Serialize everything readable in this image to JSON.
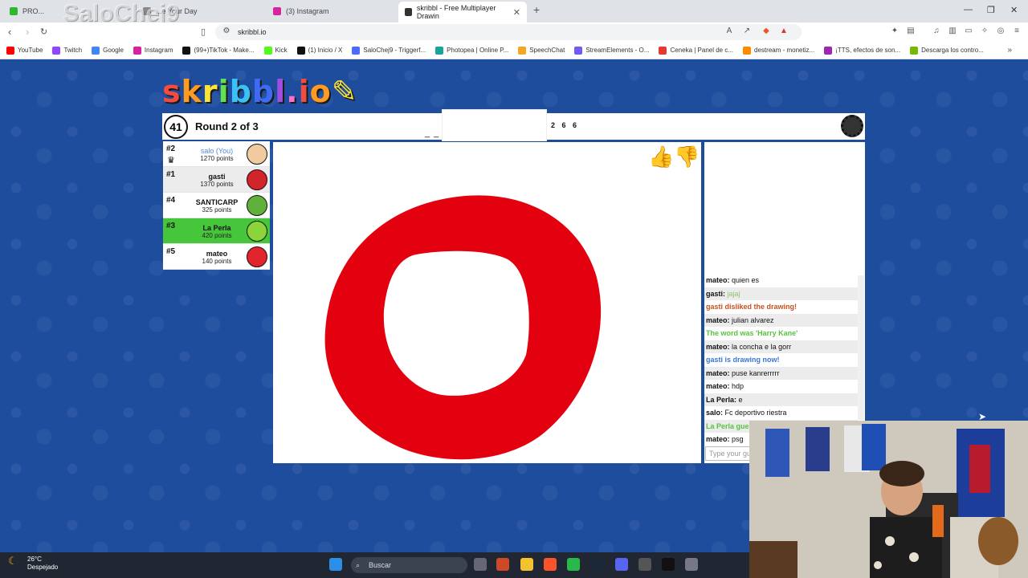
{
  "tabs": [
    {
      "label": "PRO...",
      "color": "#2eb82e"
    },
    {
      "label": "...e Your Day",
      "color": "#888888"
    },
    {
      "label": "(3) Instagram",
      "color": "#d6249f"
    },
    {
      "label": "skribbl - Free Multiplayer Drawin",
      "color": "#333333"
    }
  ],
  "url": "skribbl.io",
  "watermark": "SaloChej9",
  "bookmarks": [
    {
      "label": "YouTube",
      "color": "#ff0000"
    },
    {
      "label": "Twitch",
      "color": "#9146ff"
    },
    {
      "label": "Google",
      "color": "#4285f4"
    },
    {
      "label": "Instagram",
      "color": "#d6249f"
    },
    {
      "label": "(99+)TikTok - Make...",
      "color": "#111111"
    },
    {
      "label": "Kick",
      "color": "#53fc18"
    },
    {
      "label": "(1) Inicio / X",
      "color": "#111111"
    },
    {
      "label": "SaloChej9 - Triggerf...",
      "color": "#4a6cf7"
    },
    {
      "label": "Photopea | Online P...",
      "color": "#18a497"
    },
    {
      "label": "SpeechChat",
      "color": "#f5a623"
    },
    {
      "label": "StreamElements - O...",
      "color": "#6e5cf6"
    },
    {
      "label": "Ceneka | Panel de c...",
      "color": "#e53935"
    },
    {
      "label": "destream - monetiz...",
      "color": "#ff8a00"
    },
    {
      "label": "¡TTS, efectos de son...",
      "color": "#9c27b0"
    },
    {
      "label": "Descarga los contro...",
      "color": "#76b900"
    }
  ],
  "logo": "skribbl.io",
  "game": {
    "timer": "41",
    "round": "Round 2 of 3",
    "hint": "_ _",
    "word_length": "2 6 6"
  },
  "players": [
    {
      "rank": "#2",
      "name": "salo (You)",
      "points": "1270 points",
      "you": true,
      "color": "#f3c9a0"
    },
    {
      "rank": "#1",
      "name": "gasti",
      "points": "1370 points",
      "you": false,
      "color": "#d4242b"
    },
    {
      "rank": "#4",
      "name": "SANTICARP",
      "points": "325 points",
      "you": false,
      "color": "#5fb13a"
    },
    {
      "rank": "#3",
      "name": "La Perla",
      "points": "420 points",
      "you": false,
      "color": "#8bd43c"
    },
    {
      "rank": "#5",
      "name": "mateo",
      "points": "140 points",
      "you": false,
      "color": "#e2242c"
    }
  ],
  "chat": [
    {
      "user": "mateo:",
      "text": "quien es",
      "color": "#111111"
    },
    {
      "user": "gasti:",
      "text": "jajaj",
      "color": "#8fbf6f"
    },
    {
      "user": "",
      "text": "gasti disliked the drawing!",
      "color": "#c7511f"
    },
    {
      "user": "mateo:",
      "text": "julian alvarez",
      "color": "#111111"
    },
    {
      "user": "",
      "text": "The word was 'Harry Kane'",
      "color": "#55c43b"
    },
    {
      "user": "mateo:",
      "text": "la concha e la gorr",
      "color": "#111111"
    },
    {
      "user": "",
      "text": "gasti is drawing now!",
      "color": "#3a77d6"
    },
    {
      "user": "mateo:",
      "text": "puse kanrerrrrr",
      "color": "#111111"
    },
    {
      "user": "mateo:",
      "text": "hdp",
      "color": "#111111"
    },
    {
      "user": "La Perla:",
      "text": "e",
      "color": "#111111"
    },
    {
      "user": "salo:",
      "text": "Fc deportivo riestra",
      "color": "#111111"
    },
    {
      "user": "",
      "text": "La Perla gue...",
      "color": "#55c43b"
    },
    {
      "user": "mateo:",
      "text": "psg",
      "color": "#111111"
    }
  ],
  "chat_placeholder": "Type your gu",
  "taskbar": {
    "temp": "26°C",
    "weather": "Despejado",
    "search": "Buscar"
  }
}
